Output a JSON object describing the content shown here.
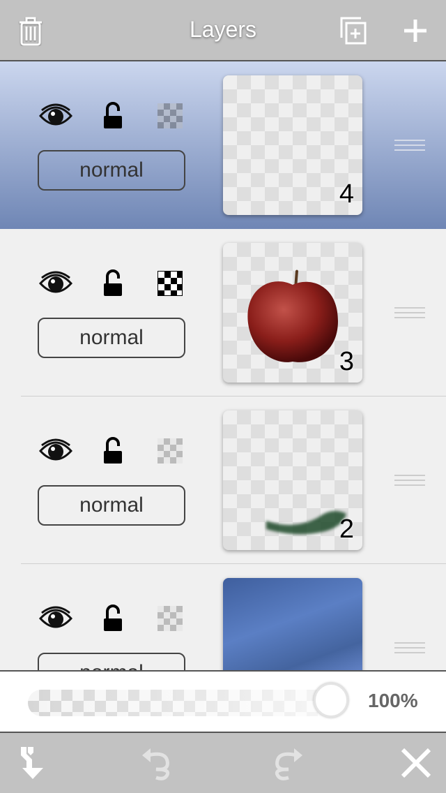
{
  "header": {
    "title": "Layers",
    "icons": [
      "trash-icon",
      "duplicate-layer-icon",
      "plus-icon"
    ]
  },
  "layers": [
    {
      "number": "4",
      "blend_mode": "normal",
      "selected": true,
      "visible": true,
      "locked": false,
      "alpha_lock": false,
      "content": "empty"
    },
    {
      "number": "3",
      "blend_mode": "normal",
      "selected": false,
      "visible": true,
      "locked": false,
      "alpha_lock": true,
      "content": "red apple"
    },
    {
      "number": "2",
      "blend_mode": "normal",
      "selected": false,
      "visible": true,
      "locked": false,
      "alpha_lock": false,
      "content": "green brush stroke"
    },
    {
      "number": "",
      "blend_mode": "normal",
      "selected": false,
      "visible": true,
      "locked": false,
      "alpha_lock": false,
      "content": "blue texture"
    }
  ],
  "opacity": {
    "value_label": "100%",
    "value": 1.0
  },
  "toolbar": {
    "icons": [
      "merge-down-icon",
      "undo-icon",
      "redo-icon",
      "close-icon"
    ]
  },
  "colors": {
    "selected_gradient_top": "#cbd6ee",
    "selected_gradient_bottom": "#6f86b5",
    "bar": "#c2c2c2"
  }
}
